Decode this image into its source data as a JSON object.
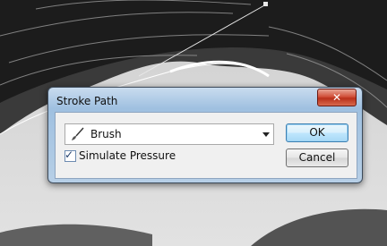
{
  "dialog": {
    "title": "Stroke Path",
    "close_symbol": "✕"
  },
  "tool_select": {
    "selected": "Brush",
    "icon": "brush-icon"
  },
  "simulate_pressure": {
    "label": "Simulate Pressure",
    "checked": true,
    "mark": "✓"
  },
  "buttons": {
    "ok": "OK",
    "cancel": "Cancel"
  }
}
